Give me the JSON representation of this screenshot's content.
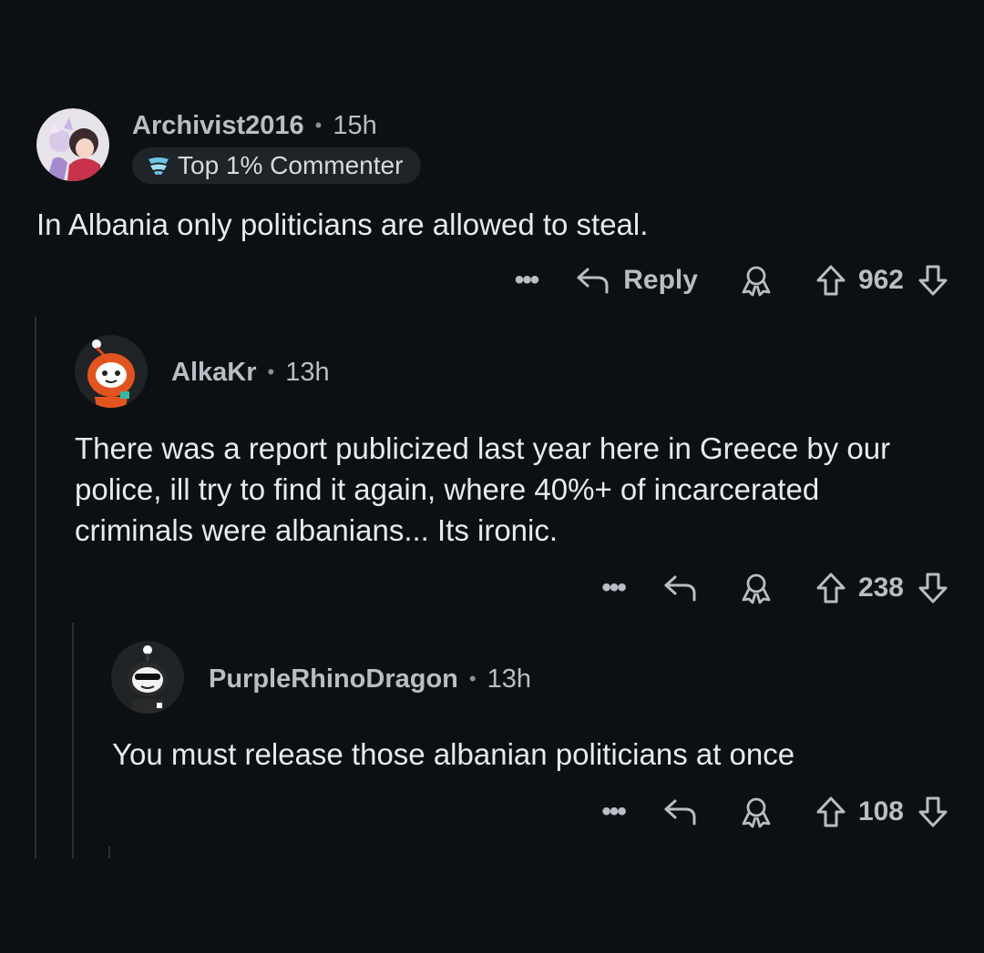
{
  "comments": [
    {
      "username": "Archivist2016",
      "time": "15h",
      "flair": "Top 1% Commenter",
      "body": "In Albania only politicians are allowed to steal.",
      "reply_label": "Reply",
      "votes": "962"
    },
    {
      "username": "AlkaKr",
      "time": "13h",
      "body": "There was a report publicized last year here in Greece by our police, ill try to find it again, where 40%+ of incarcerated criminals were albanians... Its ironic.",
      "votes": "238"
    },
    {
      "username": "PurpleRhinoDragon",
      "time": "13h",
      "body": "You must release those albanian politicians at once",
      "votes": "108"
    }
  ],
  "separator": "•",
  "more_glyph": "•••",
  "icons": {
    "more": "more-options-icon",
    "reply": "reply-arrow-icon",
    "award": "award-icon",
    "upvote": "upvote-arrow-icon",
    "downvote": "downvote-arrow-icon",
    "flair": "commenter-badge-icon"
  },
  "colors": {
    "background": "#0d1013",
    "text": "#e8eaec",
    "muted": "#b8bec4",
    "flair_bg": "#1e2428",
    "thread_line": "#2b2f33"
  }
}
